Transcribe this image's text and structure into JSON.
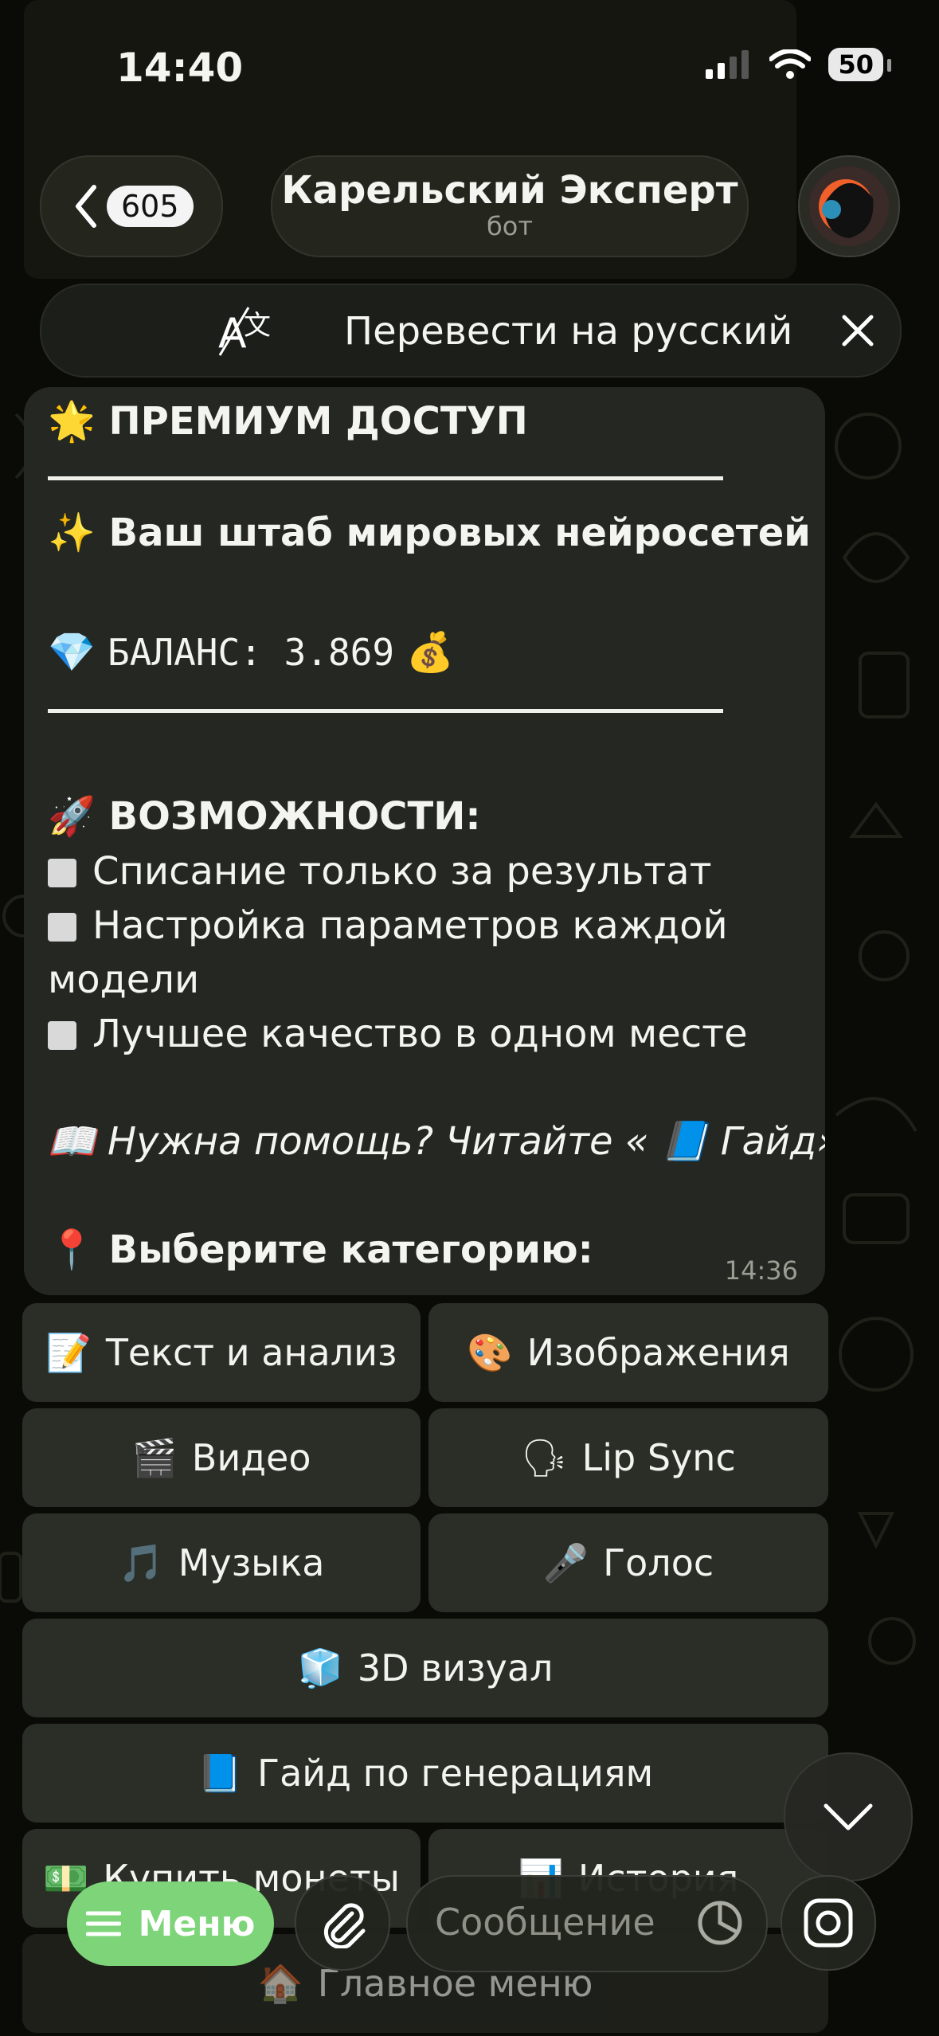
{
  "status_bar": {
    "time": "14:40",
    "battery": "50"
  },
  "header": {
    "back_count": "605",
    "title": "Карельский Эксперт",
    "subtitle": "бот"
  },
  "translate_bar": {
    "label": "Перевести на русский"
  },
  "message": {
    "premium": {
      "emoji": "🌟",
      "text": "ПРЕМИУМ ДОСТУП"
    },
    "headline": {
      "emoji": "✨",
      "text": "Ваш штаб мировых нейросетей"
    },
    "balance": {
      "emoji_left": "💎",
      "text": "БАЛАНС: 3.869",
      "emoji_right": "💰"
    },
    "features_title": {
      "emoji": "🚀",
      "text": "ВОЗМОЖНОСТИ:"
    },
    "features": [
      "Списание только за результат",
      "Настройка параметров каждой",
      "модели",
      "Лучшее качество в одном месте"
    ],
    "help": {
      "emoji": "📖",
      "text": "Нужна помощь? Читайте «",
      "emoji2": "📘",
      "text2": "Гайд»"
    },
    "choose": {
      "emoji": "📍",
      "text": "Выберите категорию:"
    },
    "time": "14:36"
  },
  "keyboard": {
    "text_analysis": {
      "emoji": "📝",
      "label": "Текст и анализ"
    },
    "images": {
      "emoji": "🎨",
      "label": "Изображения"
    },
    "video": {
      "emoji": "🎬",
      "label": "Видео"
    },
    "lipsync": {
      "emoji": "🗣",
      "label": "Lip Sync"
    },
    "music": {
      "emoji": "🎵",
      "label": "Музыка"
    },
    "voice": {
      "emoji": "🎤",
      "label": "Голос"
    },
    "visual3d": {
      "emoji": "🧊",
      "label": "3D визуал"
    },
    "guide": {
      "emoji": "📘",
      "label": "Гайд по генерациям"
    },
    "buy": {
      "emoji": "💵",
      "label": "Купить монеты"
    },
    "history": {
      "emoji": "📊",
      "label": "История"
    },
    "main_menu": {
      "emoji": "🏠",
      "label": "Главное меню"
    }
  },
  "bottom_bar": {
    "menu_label": "Меню",
    "message_placeholder": "Сообщение"
  },
  "colors": {
    "menu_green": "#7dd479",
    "bubble": "#252722",
    "button": "#2b2d27",
    "background": "#0a0b07"
  },
  "icons": [
    "back-chevron-icon",
    "translate-icon",
    "close-icon",
    "chevron-down-icon",
    "hamburger-icon",
    "paperclip-icon",
    "sticker-icon",
    "camera-icon"
  ]
}
